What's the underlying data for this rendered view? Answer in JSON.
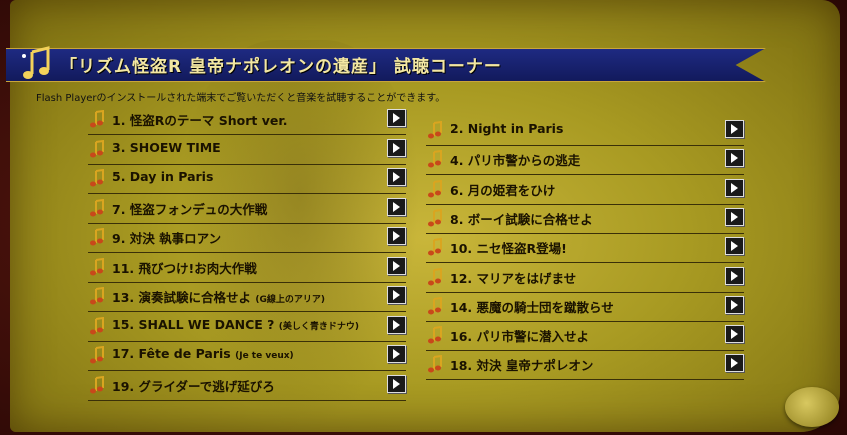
{
  "banner": {
    "title": "「リズム怪盗R 皇帝ナポレオンの遺産」 試聴コーナー"
  },
  "subtitle": "Flash Playerのインストールされた端末でご覧いただくと音楽を試聴することができます。",
  "icons": {
    "note": "music-note-icon",
    "play": "play-icon"
  },
  "colors": {
    "banner_bg": "#1e2a82",
    "banner_text": "#f3e7a2",
    "scroll": "#b8a82c"
  },
  "tracks_left": [
    {
      "label": "1. 怪盗Rのテーマ Short ver.",
      "note": ""
    },
    {
      "label": "3. SHOEW TIME",
      "note": ""
    },
    {
      "label": "5. Day in Paris",
      "note": ""
    },
    {
      "label": "7. 怪盗フォンデュの大作戦",
      "note": ""
    },
    {
      "label": "9. 対決 執事ロアン",
      "note": ""
    },
    {
      "label": "11. 飛びつけ!お肉大作戦",
      "note": ""
    },
    {
      "label": "13. 演奏試験に合格せよ",
      "note": "(G線上のアリア)"
    },
    {
      "label": "15. SHALL WE DANCE ?",
      "note": "(美しく青きドナウ)"
    },
    {
      "label": "17. Fête de Paris",
      "note": "(Je te veux)"
    },
    {
      "label": "19. グライダーで逃げ延びろ",
      "note": ""
    }
  ],
  "tracks_right": [
    {
      "label": "2. Night in Paris",
      "note": ""
    },
    {
      "label": "4. パリ市警からの逃走",
      "note": ""
    },
    {
      "label": "6. 月の姫君をひけ",
      "note": ""
    },
    {
      "label": "8. ボーイ試験に合格せよ",
      "note": ""
    },
    {
      "label": "10. ニセ怪盗R登場!",
      "note": ""
    },
    {
      "label": "12. マリアをはげませ",
      "note": ""
    },
    {
      "label": "14. 悪魔の騎士団を蹴散らせ",
      "note": ""
    },
    {
      "label": "16. パリ市警に潜入せよ",
      "note": ""
    },
    {
      "label": "18. 対決 皇帝ナポレオン",
      "note": ""
    }
  ]
}
